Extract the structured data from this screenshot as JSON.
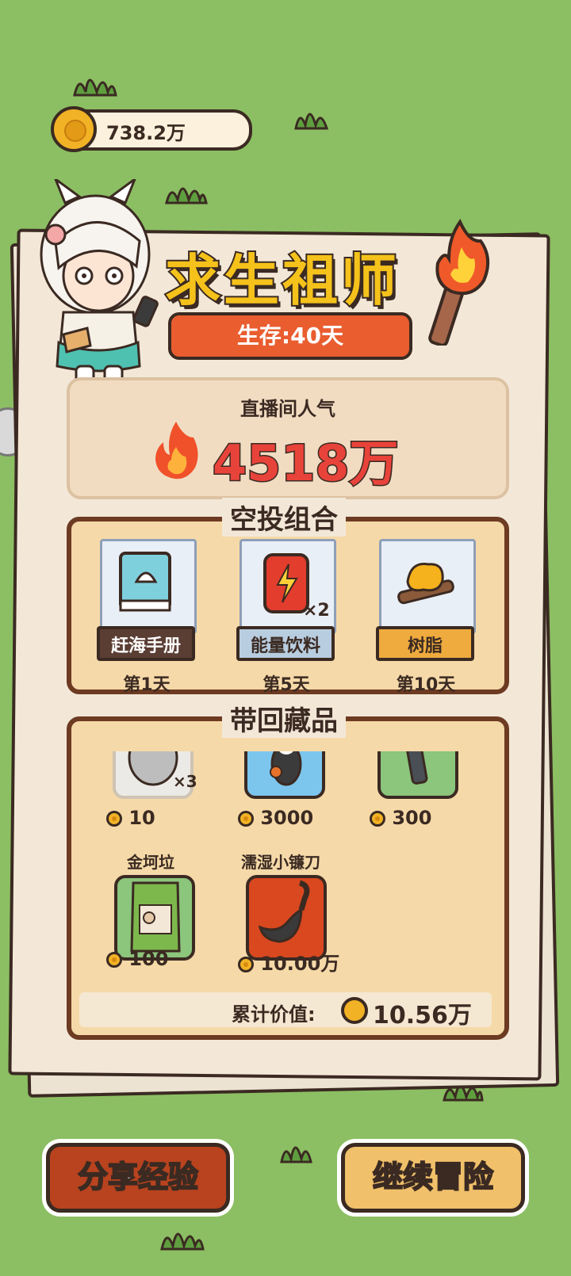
{
  "header": {
    "coin_amount": "738.2万"
  },
  "card": {
    "title": "求生祖师",
    "survival_days": "生存:40天",
    "popularity_label": "直播间人气",
    "popularity_value": "4518万"
  },
  "airdrop": {
    "title": "空投组合",
    "items": [
      {
        "name": "赶海手册",
        "day": "第1天",
        "count": "",
        "label_bg": "#5a3d33",
        "label_color": "#ffffff"
      },
      {
        "name": "能量饮料",
        "day": "第5天",
        "count": "×2",
        "label_bg": "#b8cde0",
        "label_color": "#3b2a22"
      },
      {
        "name": "树脂",
        "day": "第10天",
        "count": "",
        "label_bg": "#efab3e",
        "label_color": "#3b2a22"
      }
    ]
  },
  "collection": {
    "title": "带回藏品",
    "items": [
      {
        "name": "",
        "price": "10",
        "count": "×3"
      },
      {
        "name": "",
        "price": "3000",
        "count": ""
      },
      {
        "name": "",
        "price": "300",
        "count": ""
      },
      {
        "name": "金坷垃",
        "price": "100",
        "count": ""
      },
      {
        "name": "濡湿小镰刀",
        "price": "10.00万",
        "count": ""
      }
    ],
    "total_label": "累计价值:",
    "total_value": "10.56万"
  },
  "buttons": {
    "share": "分享经验",
    "continue": "继续冒险"
  },
  "colors": {
    "background": "#8cbf63",
    "accent_red": "#e95d2f",
    "gold": "#f5c21b",
    "brown": "#6d3a22"
  }
}
